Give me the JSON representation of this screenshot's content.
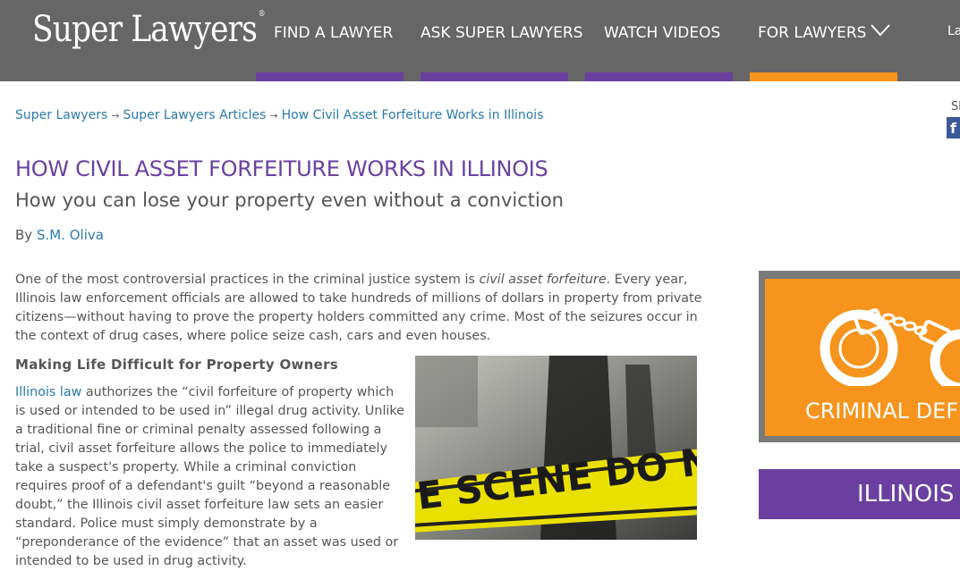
{
  "header": {
    "logo": "Super Lawyers",
    "logo_mark": "®",
    "nav": [
      "FIND A LAWYER",
      "ASK SUPER LAWYERS",
      "WATCH VIDEOS",
      "FOR LAWYERS"
    ],
    "nav_cut": "La",
    "nav_bar_colors": [
      "#6b3fa0",
      "#6b3fa0",
      "#6b3fa0",
      "#f7941d"
    ]
  },
  "breadcrumb": [
    "Super Lawyers",
    "Super Lawyers Articles",
    "How Civil Asset Forfeiture Works in Illinois"
  ],
  "breadcrumb_sep": "→",
  "article": {
    "title": "HOW CIVIL ASSET FORFEITURE WORKS IN ILLINOIS",
    "subtitle": "How you can lose your property even without a conviction",
    "by_label": "By",
    "author": "S.M. Oliva",
    "intro_pre": "One of the most controversial practices in the criminal justice system is ",
    "intro_em": "civil asset forfeiture",
    "intro_post": ". Every year, Illinois law enforcement officials are allowed to take hundreds of millions of dollars in property from private citizens—without having to prove the property holders committed any crime. Most of the seizures occur in the context of drug cases, where police seize cash, cars and even houses.",
    "section_heading": "Making Life Difficult for Property Owners",
    "body_link": "Illinois law",
    "body_text": " authorizes the “civil forfeiture of property which is used or intended to be used in” illegal drug activity. Unlike a traditional fine or criminal penalty assessed following a trial, civil asset forfeiture allows the police to immediately take a suspect's property. While a criminal conviction requires proof of a defendant's guilt “beyond a reasonable doubt,” the Illinois civil asset forfeiture law sets an easier standard. Police must simply demonstrate by a “preponderance of the evidence” that an asset was used or intended to be used in drug activity.",
    "photo_tape_text": "E SCENE DO NOT CROSS"
  },
  "sidebar": {
    "share_label": "Sh",
    "fb_glyph": "f",
    "promo_text": "CRIMINAL DEFE",
    "state_text": "ILLINOIS"
  },
  "colors": {
    "purple": "#6b3fa0",
    "orange": "#f7941d",
    "link": "#2a7ab0",
    "header": "#666666"
  }
}
